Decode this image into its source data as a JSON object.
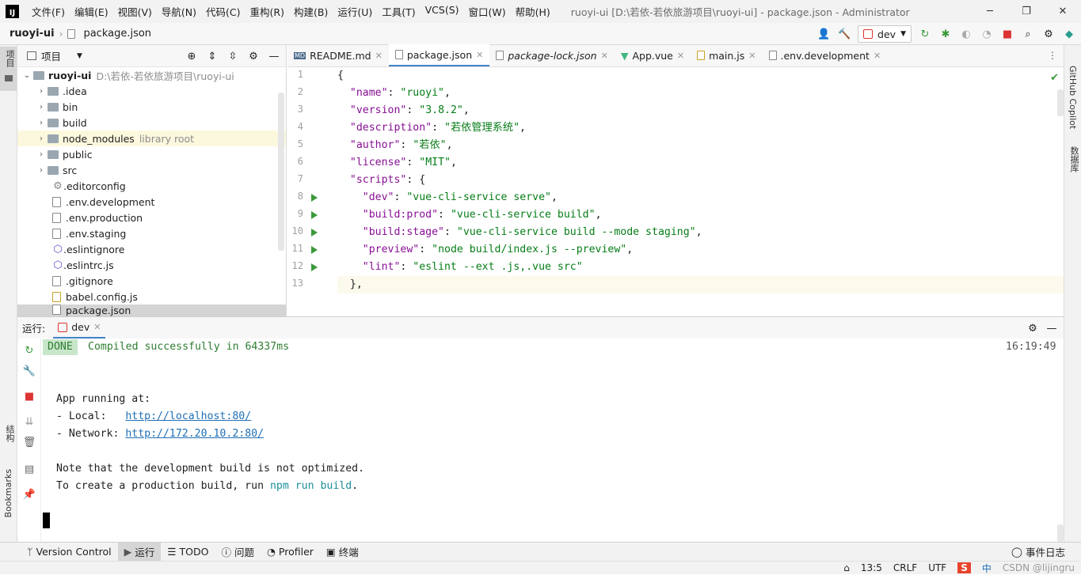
{
  "app": {
    "window_title": "ruoyi-ui [D:\\若依-若依旅游项目\\ruoyi-ui] - package.json - Administrator",
    "menu": [
      "文件(F)",
      "编辑(E)",
      "视图(V)",
      "导航(N)",
      "代码(C)",
      "重构(R)",
      "构建(B)",
      "运行(U)",
      "工具(T)",
      "VCS(S)",
      "窗口(W)",
      "帮助(H)"
    ]
  },
  "navbar": {
    "project": "ruoyi-ui",
    "file": "package.json",
    "run_config": "dev"
  },
  "left_strip": {
    "project_label": "项目",
    "structure_label": "结构",
    "bookmarks_label": "Bookmarks"
  },
  "right_strip": {
    "copilot_label": "GitHub Copilot",
    "database_label": "数据库"
  },
  "project_panel": {
    "title": "项目",
    "root": {
      "name": "ruoyi-ui",
      "path": "D:\\若依-若依旅游项目\\ruoyi-ui"
    },
    "items": [
      {
        "name": ".idea",
        "type": "folder",
        "note": ""
      },
      {
        "name": "bin",
        "type": "folder",
        "note": ""
      },
      {
        "name": "build",
        "type": "folder",
        "note": ""
      },
      {
        "name": "node_modules",
        "type": "folder",
        "note": "library root"
      },
      {
        "name": "public",
        "type": "folder",
        "note": ""
      },
      {
        "name": "src",
        "type": "folder",
        "note": ""
      },
      {
        "name": ".editorconfig",
        "type": "file",
        "note": ""
      },
      {
        "name": ".env.development",
        "type": "file",
        "note": ""
      },
      {
        "name": ".env.production",
        "type": "file",
        "note": ""
      },
      {
        "name": ".env.staging",
        "type": "file",
        "note": ""
      },
      {
        "name": ".eslintignore",
        "type": "file",
        "note": ""
      },
      {
        "name": ".eslintrc.js",
        "type": "file",
        "note": ""
      },
      {
        "name": ".gitignore",
        "type": "file",
        "note": ""
      },
      {
        "name": "babel.config.js",
        "type": "file",
        "note": ""
      },
      {
        "name": "package.json",
        "type": "file",
        "note": ""
      }
    ]
  },
  "editor": {
    "tabs": [
      {
        "label": "README.md"
      },
      {
        "label": "package.json"
      },
      {
        "label": "package-lock.json"
      },
      {
        "label": "App.vue"
      },
      {
        "label": "main.js"
      },
      {
        "label": ".env.development"
      }
    ],
    "active_tab": "package.json",
    "line_numbers": [
      "1",
      "2",
      "3",
      "4",
      "5",
      "6",
      "7",
      "8",
      "9",
      "10",
      "11",
      "12",
      "13"
    ],
    "lines": {
      "l1": "{",
      "l2_key": "\"name\"",
      "l2_val": "\"ruoyi\"",
      "l3_key": "\"version\"",
      "l3_val": "\"3.8.2\"",
      "l4_key": "\"description\"",
      "l4_val": "\"若依管理系统\"",
      "l5_key": "\"author\"",
      "l5_val": "\"若依\"",
      "l6_key": "\"license\"",
      "l6_val": "\"MIT\"",
      "l7_key": "\"scripts\"",
      "l7_rest": ": {",
      "l8_key": "\"dev\"",
      "l8_val": "\"vue-cli-service serve\"",
      "l9_key": "\"build:prod\"",
      "l9_val": "\"vue-cli-service build\"",
      "l10_key": "\"build:stage\"",
      "l10_val": "\"vue-cli-service build --mode staging\"",
      "l11_key": "\"preview\"",
      "l11_val": "\"node build/index.js --preview\"",
      "l12_key": "\"lint\"",
      "l12_val": "\"eslint --ext .js,.vue src\"",
      "l13": "},"
    }
  },
  "run_panel": {
    "label": "运行:",
    "tab": "dev",
    "done_badge": "DONE",
    "compiled": "Compiled successfully in 64337ms",
    "time": "16:19:49",
    "app_running": "App running at:",
    "local_label": "- Local:   ",
    "local_url": "http://localhost:80/",
    "network_label": "- Network: ",
    "network_url": "http://172.20.10.2:80/",
    "note": "Note that the development build is not optimized.",
    "create_prefix": "To create a production build, run ",
    "create_cmd": "npm run build",
    "create_suffix": "."
  },
  "statusbar": {
    "items": [
      "Version Control",
      "运行",
      "TODO",
      "问题",
      "Profiler",
      "终端"
    ],
    "event_log": "事件日志"
  },
  "bottombar": {
    "position": "13:5",
    "line_sep": "CRLF",
    "encoding": "UTF",
    "ime": "中",
    "watermark": "CSDN @lijingru"
  }
}
